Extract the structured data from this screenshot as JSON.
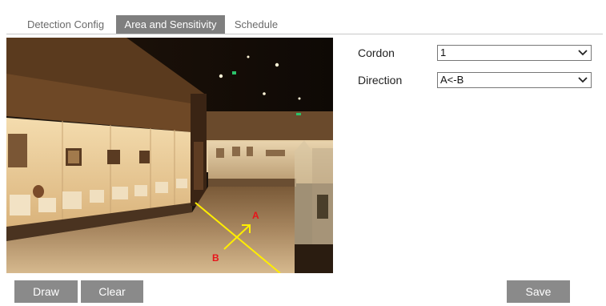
{
  "tabs": [
    {
      "label": "Detection Config",
      "active": false
    },
    {
      "label": "Area and Sensitivity",
      "active": true
    },
    {
      "label": "Schedule",
      "active": false
    }
  ],
  "video": {
    "line_color": "#ffee00",
    "marker_color": "#e8141a",
    "marker_a": "A",
    "marker_b": "B"
  },
  "form": {
    "cordon": {
      "label": "Cordon",
      "value": "1"
    },
    "direction": {
      "label": "Direction",
      "value": "A<-B"
    }
  },
  "buttons": {
    "draw": "Draw",
    "clear": "Clear",
    "save": "Save"
  }
}
